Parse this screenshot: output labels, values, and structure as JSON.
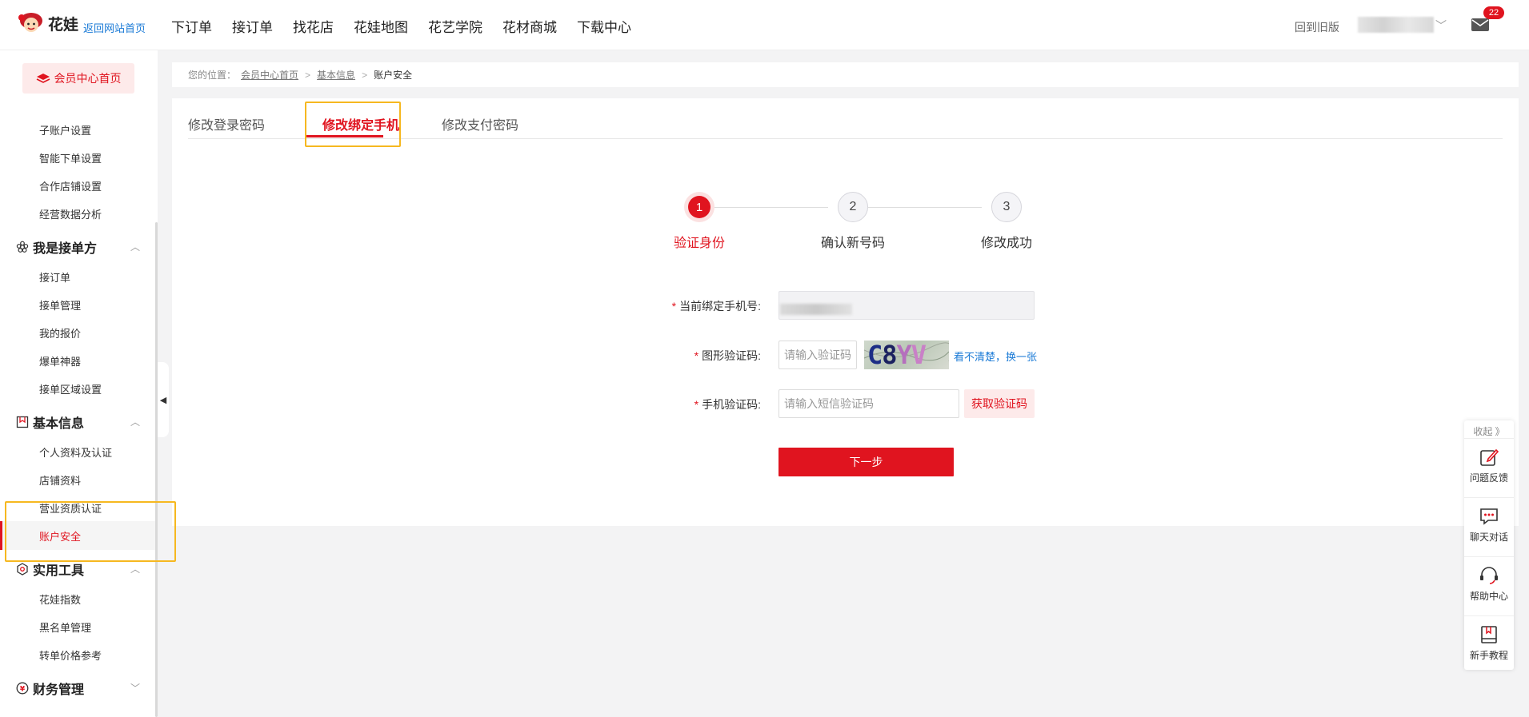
{
  "header": {
    "logo_text": "花娃",
    "back_home": "返回网站首页",
    "nav": [
      "下订单",
      "接订单",
      "找花店",
      "花娃地图",
      "花艺学院",
      "花材商城",
      "下载中心"
    ],
    "old_version": "回到旧版",
    "mail_count": "22"
  },
  "sidebar": {
    "member_home": "会员中心首页",
    "items_top": [
      "子账户设置",
      "智能下单设置",
      "合作店铺设置",
      "经营数据分析"
    ],
    "group_receiver": "我是接单方",
    "items_receiver": [
      "接订单",
      "接单管理",
      "我的报价",
      "爆单神器",
      "接单区域设置"
    ],
    "group_basic": "基本信息",
    "items_basic": [
      "个人资料及认证",
      "店铺资料",
      "营业资质认证",
      "账户安全"
    ],
    "group_tools": "实用工具",
    "items_tools": [
      "花娃指数",
      "黑名单管理",
      "转单价格参考"
    ],
    "group_finance": "财务管理",
    "caret_up": "︿",
    "caret_down": "﹀"
  },
  "breadcrumb": {
    "prefix": "您的位置：",
    "crumbs": [
      "会员中心首页",
      "基本信息"
    ],
    "current": "账户安全",
    "separator": ">"
  },
  "tabs": [
    "修改登录密码",
    "修改绑定手机",
    "修改支付密码"
  ],
  "steps": [
    {
      "number": "1",
      "label": "验证身份"
    },
    {
      "number": "2",
      "label": "确认新号码"
    },
    {
      "number": "3",
      "label": "修改成功"
    }
  ],
  "form": {
    "required_mark": "*",
    "current_phone_label": "当前绑定手机号:",
    "captcha_label": "图形验证码:",
    "captcha_placeholder": "请输入验证码",
    "captcha_image_text": "C8YV",
    "refresh_link": "看不清楚，换一张",
    "sms_label": "手机验证码:",
    "sms_placeholder": "请输入短信验证码",
    "sms_button": "获取验证码",
    "next_button": "下一步"
  },
  "float_toolbar": {
    "collapse": "收起 》",
    "items": [
      "问题反馈",
      "聊天对话",
      "帮助中心",
      "新手教程"
    ]
  },
  "colors": {
    "accent": "#e0141f",
    "highlight": "#f6b820",
    "link": "#1a7ad6"
  }
}
